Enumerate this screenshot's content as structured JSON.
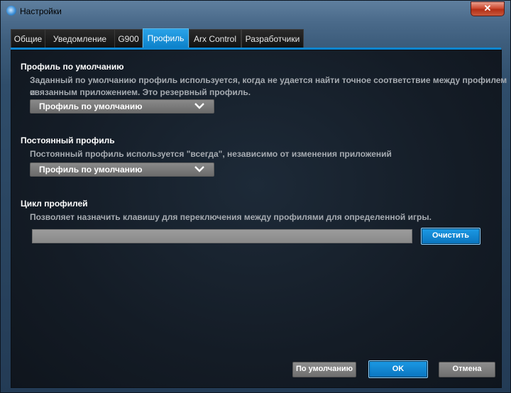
{
  "window": {
    "title": "Настройки",
    "close_label": "✕"
  },
  "tabs": [
    {
      "label": "Общие"
    },
    {
      "label": "Уведомление"
    },
    {
      "label": "G900"
    },
    {
      "label": "Профиль",
      "active": true
    },
    {
      "label": "Arx Control"
    },
    {
      "label": "Разработчики"
    }
  ],
  "default_profile": {
    "title": "Профиль по умолчанию",
    "description_line1": "Заданный по умолчанию профиль используется, когда не удается найти точное соответствие между профилем и",
    "description_line2": "связанным приложением. Это резервный профиль.",
    "selected": "Профиль по умолчанию"
  },
  "persistent_profile": {
    "title": "Постоянный профиль",
    "description": "Постоянный профиль используется \"всегда\", независимо от изменения приложений",
    "selected": "Профиль по умолчанию"
  },
  "profile_cycle": {
    "title": "Цикл профилей",
    "description": "Позволяет назначить клавишу для переключения между профилями для определенной игры.",
    "key_value": "",
    "clear_label": "Очистить"
  },
  "footer": {
    "defaults_label": "По умолчанию",
    "ok_label": "OK",
    "cancel_label": "Отмена"
  },
  "colors": {
    "accent": "#0e86d0",
    "close": "#c9412a"
  }
}
